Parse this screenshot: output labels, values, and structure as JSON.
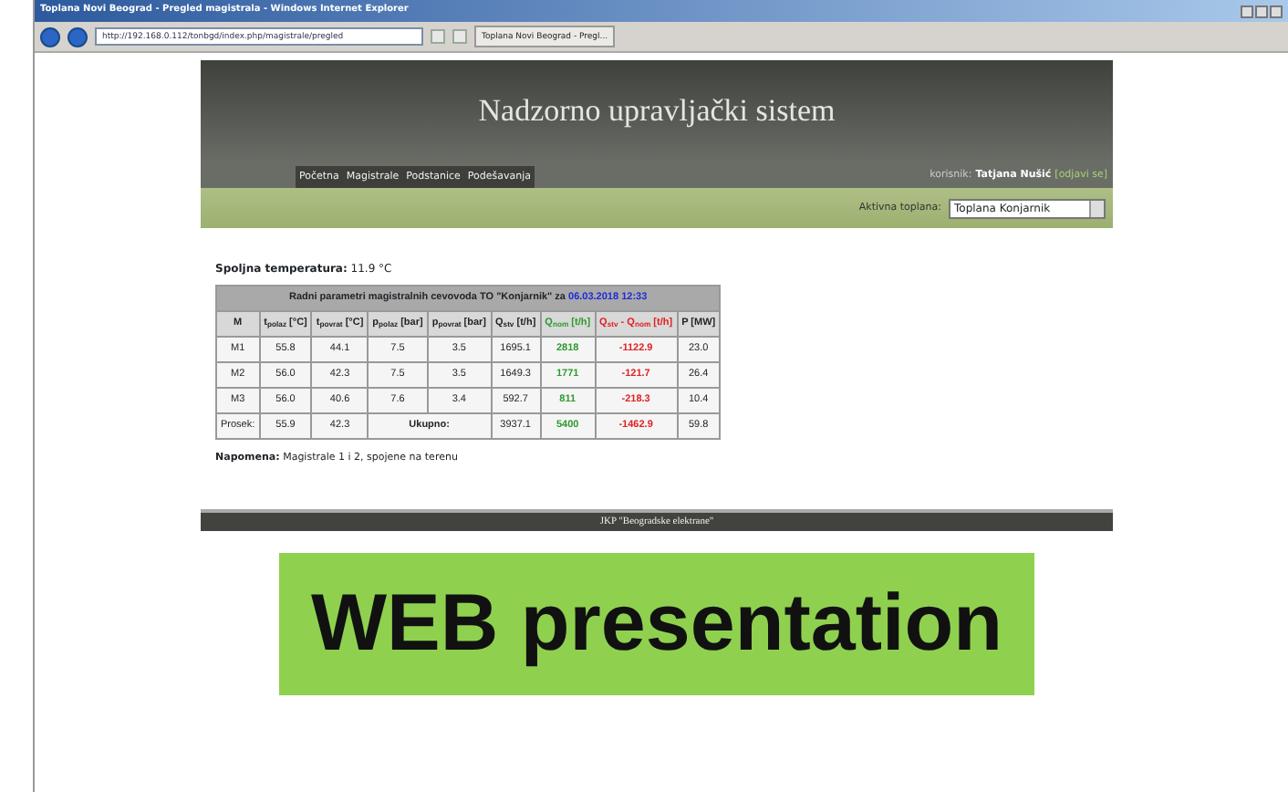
{
  "window": {
    "title": "Toplana Novi Beograd - Pregled magistrala - Windows Internet Explorer",
    "address": "http://192.168.0.112/tonbgd/index.php/magistrale/pregled",
    "tab": "Toplana Novi Beograd - Pregl..."
  },
  "header": {
    "title": "Nadzorno upravljački sistem"
  },
  "nav": [
    {
      "label": "Početna"
    },
    {
      "label": "Magistrale"
    },
    {
      "label": "Podstanice"
    },
    {
      "label": "Podešavanja"
    }
  ],
  "user": {
    "label": "korisnik:",
    "name": "Tatjana Nušić",
    "logout": "[odjavi se]"
  },
  "plant": {
    "label": "Aktivna toplana:",
    "value": "Toplana Konjarnik"
  },
  "temperature": {
    "label": "Spoljna temperatura:",
    "value": "11.9 °C"
  },
  "table": {
    "title": "Radni parametri magistralnih cevovoda TO \"Konjarnik\" za",
    "date": "06.03.2018 12:33",
    "columns": [
      {
        "label": "M"
      },
      {
        "label": "t$_{polaz}$ [°C]"
      },
      {
        "label": "t$_{povrat}$ [°C]"
      },
      {
        "label": "p$_{polaz}$ [bar]"
      },
      {
        "label": "p$_{povrat}$ [bar]"
      },
      {
        "label": "Q$_{stv}$ [t/h]"
      },
      {
        "label": "Q$_{nom}$ [t/h]",
        "color": "#2e9a2e"
      },
      {
        "label": "Q$_{stv}$ - Q$_{nom}$ [t/h]",
        "color": "#e02020"
      },
      {
        "label": "P [MW]"
      }
    ],
    "rows": [
      {
        "cells": [
          {
            "text": "M1"
          },
          {
            "text": "55.8"
          },
          {
            "text": "44.1"
          },
          {
            "text": "7.5"
          },
          {
            "text": "3.5"
          },
          {
            "text": "1695.1"
          },
          {
            "text": "2818"
          },
          {
            "text": "-1122.9"
          },
          {
            "text": "23.0"
          }
        ]
      },
      {
        "cells": [
          {
            "text": "M2"
          },
          {
            "text": "56.0"
          },
          {
            "text": "42.3"
          },
          {
            "text": "7.5"
          },
          {
            "text": "3.5"
          },
          {
            "text": "1649.3"
          },
          {
            "text": "1771"
          },
          {
            "text": "-121.7"
          },
          {
            "text": "26.4"
          }
        ]
      },
      {
        "cells": [
          {
            "text": "M3"
          },
          {
            "text": "56.0"
          },
          {
            "text": "40.6"
          },
          {
            "text": "7.6"
          },
          {
            "text": "3.4"
          },
          {
            "text": "592.7"
          },
          {
            "text": "811"
          },
          {
            "text": "-218.3"
          },
          {
            "text": "10.4"
          }
        ]
      },
      {
        "cells": [
          {
            "text": "Prosek:"
          },
          {
            "text": "55.9"
          },
          {
            "text": "42.3"
          },
          {
            "text": "Ukupno:",
            "colspan": 2
          },
          {
            "text": "3937.1"
          },
          {
            "text": "5400"
          },
          {
            "text": "-1462.9"
          },
          {
            "text": "59.8"
          }
        ]
      }
    ]
  },
  "note": {
    "label": "Napomena:",
    "text": "Magistrale 1 i 2, spojene na terenu"
  },
  "footer": "JKP \"Beogradske elektrane\"",
  "caption": "WEB presentation"
}
